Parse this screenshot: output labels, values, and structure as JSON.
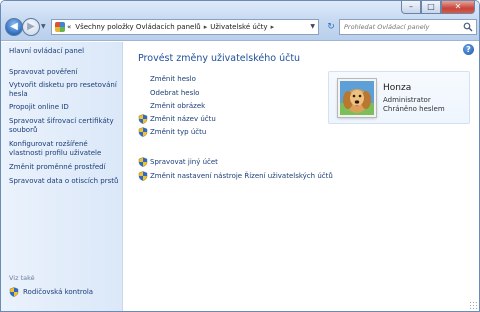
{
  "window": {
    "controls": {
      "minimize": "–",
      "maximize": "□",
      "close": "✕"
    }
  },
  "nav": {
    "back_glyph": "◀",
    "forward_glyph": "▶",
    "recent_glyph": "▼",
    "refresh_glyph": "↻"
  },
  "address": {
    "overflow": "«",
    "crumbs": [
      "Všechny položky Ovládacích panelů",
      "Uživatelské účty"
    ],
    "separator": "▸",
    "dropdown": "▼"
  },
  "search": {
    "placeholder": "Prohledat Ovládací panely"
  },
  "help": {
    "glyph": "?"
  },
  "sidebar": {
    "home": "Hlavní ovládací panel",
    "items": [
      "Spravovat pověření",
      "Vytvořit disketu pro resetování hesla",
      "Propojit online ID",
      "Spravovat šifrovací certifikáty souborů",
      "Konfigurovat rozšířené vlastnosti profilu uživatele",
      "Změnit proměnné prostředí",
      "Spravovat data o otiscích prstů"
    ],
    "see_also": "Viz také",
    "parental_controls": "Rodičovská kontrola"
  },
  "main": {
    "heading": "Provést změny uživatelského účtu",
    "tasks": [
      {
        "label": "Změnit heslo",
        "shield": false
      },
      {
        "label": "Odebrat heslo",
        "shield": false
      },
      {
        "label": "Změnit obrázek",
        "shield": false
      },
      {
        "label": "Změnit název účtu",
        "shield": true
      },
      {
        "label": "Změnit typ účtu",
        "shield": true
      }
    ],
    "tasks2": [
      {
        "label": "Spravovat jiný účet",
        "shield": true
      },
      {
        "label": "Změnit nastavení nástroje Řízení uživatelských účtů",
        "shield": true
      }
    ]
  },
  "user": {
    "name": "Honza",
    "role": "Administrator",
    "password_status": "Chráněno heslem"
  },
  "colors": {
    "link": "#1b3d78",
    "heading": "#1d4f9c",
    "sidebar_bg": "#dbe8f8"
  }
}
